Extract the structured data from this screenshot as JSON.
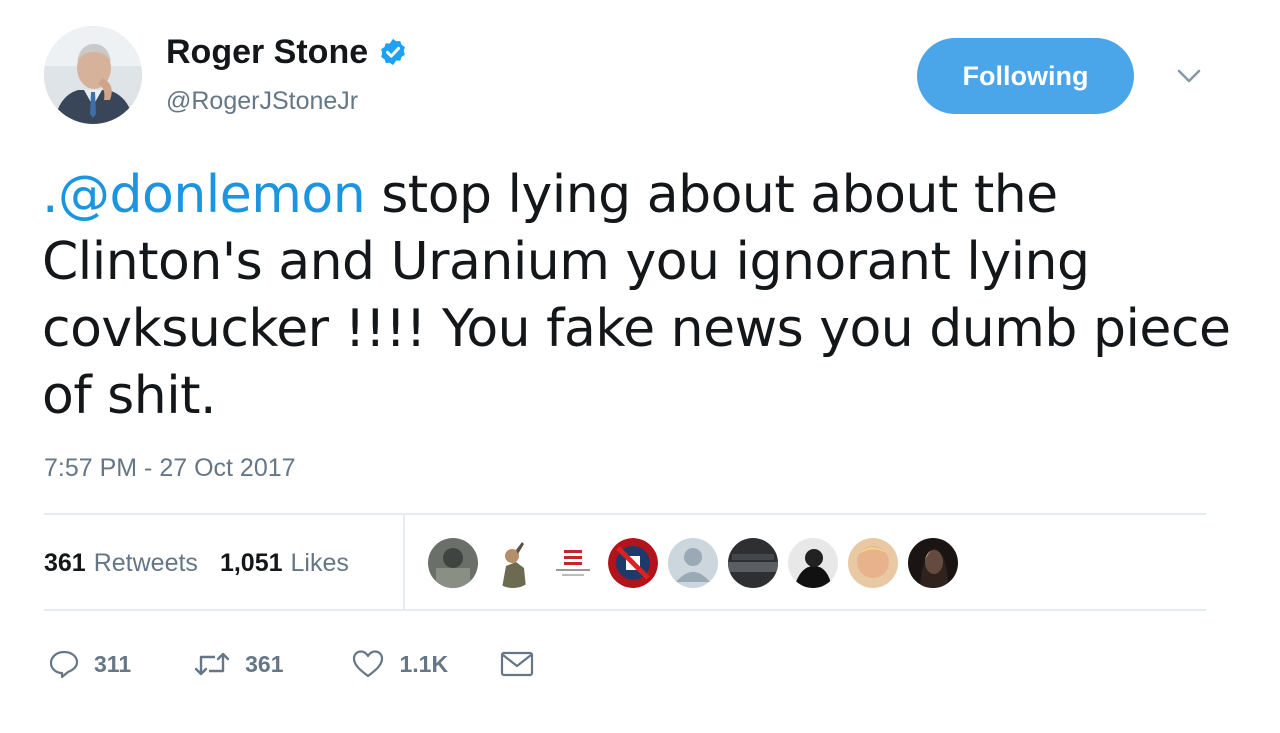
{
  "user": {
    "display_name": "Roger Stone",
    "handle": "@RogerJStoneJr",
    "verified_icon": "verified-badge-icon"
  },
  "follow_button": {
    "label": "Following"
  },
  "tweet": {
    "mention": ".@donlemon",
    "text": " stop lying about about the Clinton's and Uranium you ignorant lying covksucker !!!! You fake news you dumb piece of shit.",
    "timestamp": "7:57 PM - 27 Oct 2017"
  },
  "stats": {
    "retweets_count": "361",
    "retweets_label": "Retweets",
    "likes_count": "1,051",
    "likes_label": "Likes"
  },
  "actions": {
    "replies": "311",
    "retweets": "361",
    "likes": "1.1K"
  },
  "colors": {
    "accent": "#1b95e0",
    "button": "#4aa6e9",
    "muted": "#657786",
    "divider": "#e6ecf0"
  }
}
